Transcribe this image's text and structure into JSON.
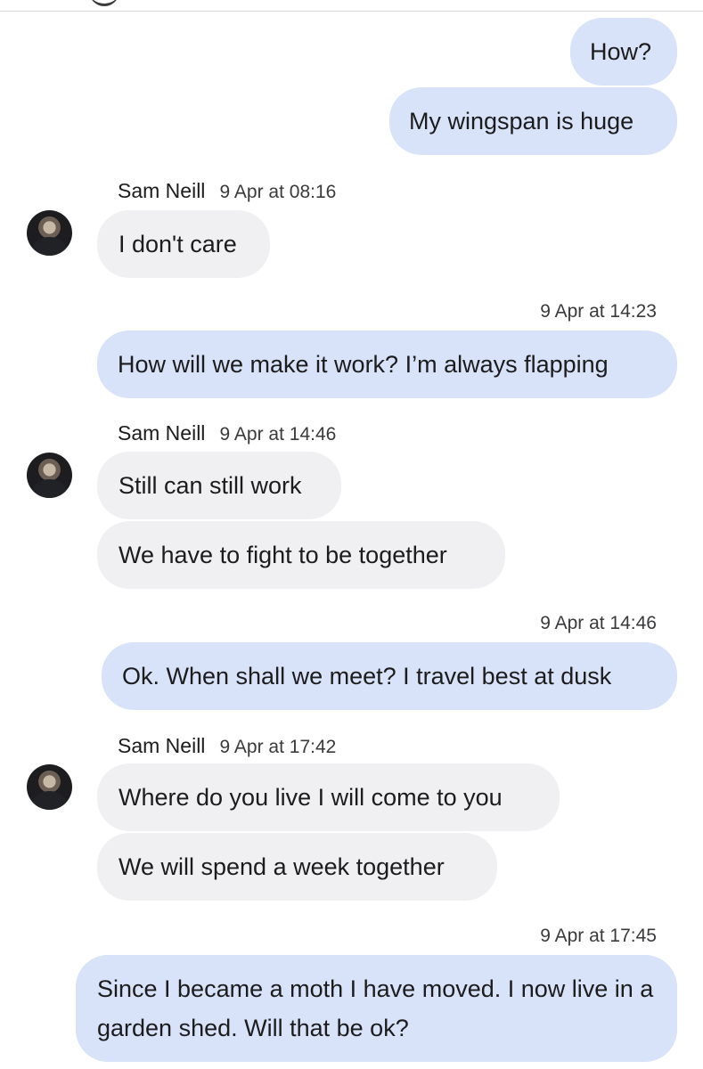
{
  "contact": {
    "name": "Sam Neill"
  },
  "messages": [
    {
      "side": "out",
      "text": "How?"
    },
    {
      "side": "out",
      "text": "My wingspan is huge"
    },
    {
      "side": "in",
      "sender": "Sam Neill",
      "time": "9 Apr at 08:16",
      "text": "I don't care"
    },
    {
      "side": "out",
      "time": "9 Apr at 14:23",
      "text": "How will we make it work? I’m always flapping"
    },
    {
      "side": "in",
      "sender": "Sam Neill",
      "time": "9 Apr at 14:46",
      "text": "Still can still work"
    },
    {
      "side": "in",
      "text": "We have to fight to be together"
    },
    {
      "side": "out",
      "time": "9 Apr at 14:46",
      "text": "Ok. When shall we meet? I travel best at dusk"
    },
    {
      "side": "in",
      "sender": "Sam Neill",
      "time": "9 Apr at 17:42",
      "text": "Where do you live I will come to you"
    },
    {
      "side": "in",
      "text": "We will spend a week together"
    },
    {
      "side": "out",
      "time": "9 Apr at 17:45",
      "text": "Since I became a moth I have moved. I now live in a garden shed. Will that be ok?"
    }
  ],
  "icons": {
    "avatar": "contact-avatar"
  }
}
